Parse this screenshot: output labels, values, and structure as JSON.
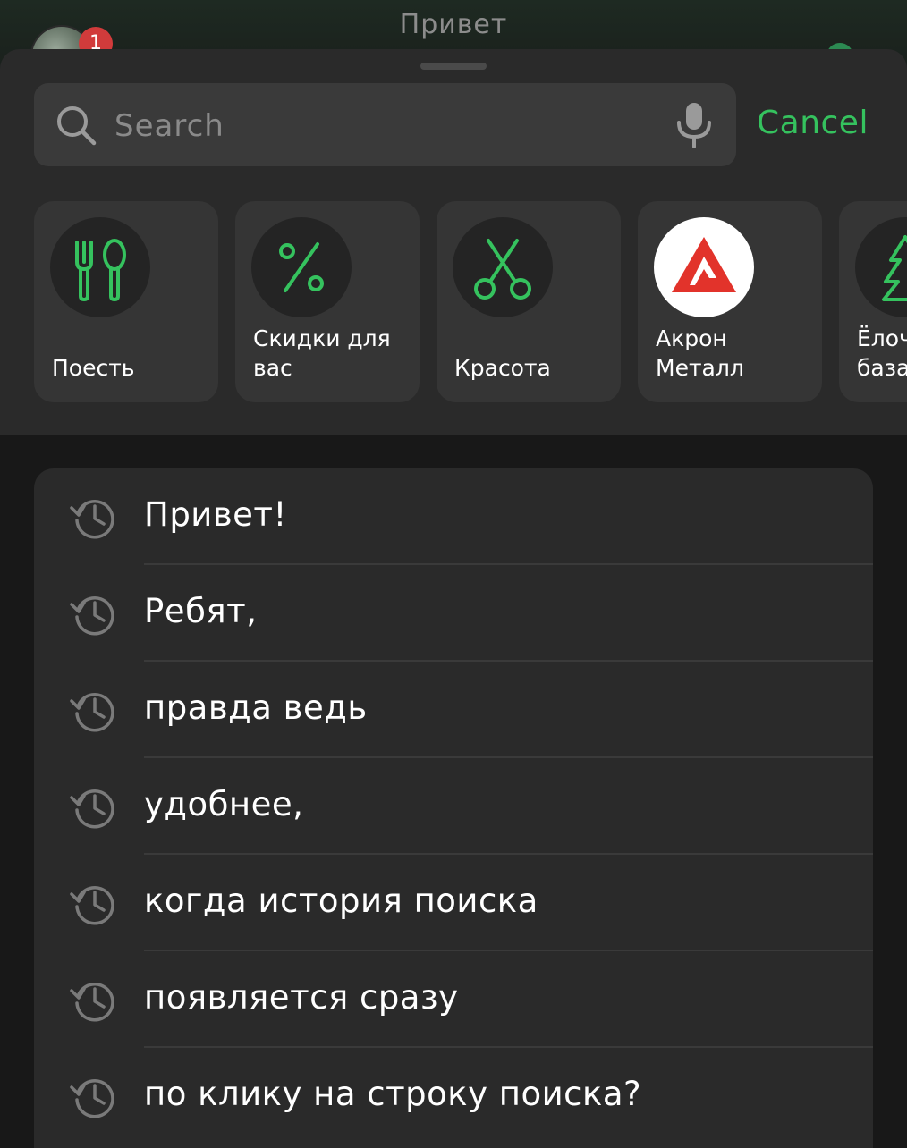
{
  "map": {
    "title": "Привет",
    "notification_count": "1"
  },
  "search": {
    "placeholder": "Search",
    "cancel_label": "Cancel"
  },
  "categories": [
    {
      "label": "Поесть",
      "icon": "fork-spoon-icon"
    },
    {
      "label": "Скидки для вас",
      "icon": "percent-icon"
    },
    {
      "label": "Красота",
      "icon": "scissors-icon"
    },
    {
      "label": "Акрон Металл",
      "icon": "akron-logo"
    },
    {
      "label": "Ёлочные базары",
      "icon": "fir-tree-icon"
    }
  ],
  "history": [
    "Привет!",
    "Ребят,",
    "правда ведь",
    "удобнее,",
    "когда история поиска",
    "появляется сразу",
    "по клику на строку поиска?"
  ],
  "colors": {
    "accent": "#35c25e",
    "background": "#181818",
    "sheet": "#2a2a2a",
    "badge": "#d13b3b"
  }
}
